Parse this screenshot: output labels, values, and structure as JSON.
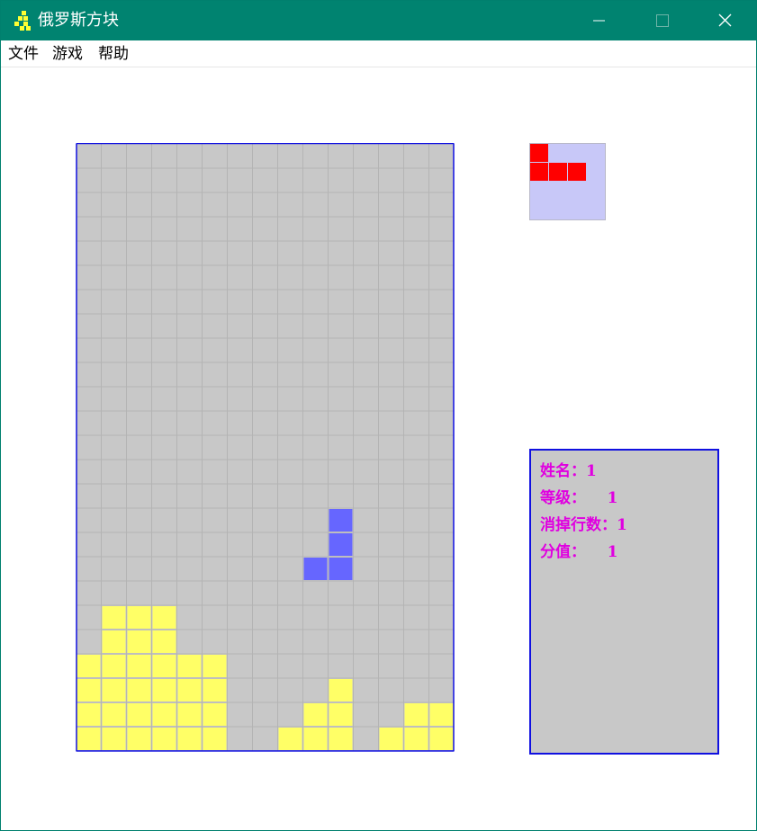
{
  "window": {
    "title": "俄罗斯方块",
    "controls": {
      "minimize": "minimize-icon",
      "maximize": "maximize-icon",
      "close": "close-icon"
    },
    "colors": {
      "titlebar": "#008370"
    }
  },
  "menu": [
    {
      "label": "文件"
    },
    {
      "label": "游戏"
    },
    {
      "label": "帮助"
    }
  ],
  "board": {
    "columns": 15,
    "rows": 25,
    "colors": {
      "empty": "#c8c8c8",
      "grid": "#b4b4b4",
      "stack": "#ffff66",
      "active": "#6666ff",
      "border": "#1010e0"
    },
    "stack_cells": [
      [
        1,
        19
      ],
      [
        2,
        19
      ],
      [
        3,
        19
      ],
      [
        1,
        20
      ],
      [
        2,
        20
      ],
      [
        3,
        20
      ],
      [
        0,
        21
      ],
      [
        1,
        21
      ],
      [
        2,
        21
      ],
      [
        3,
        21
      ],
      [
        4,
        21
      ],
      [
        5,
        21
      ],
      [
        0,
        22
      ],
      [
        1,
        22
      ],
      [
        2,
        22
      ],
      [
        3,
        22
      ],
      [
        4,
        22
      ],
      [
        5,
        22
      ],
      [
        10,
        22
      ],
      [
        0,
        23
      ],
      [
        1,
        23
      ],
      [
        2,
        23
      ],
      [
        3,
        23
      ],
      [
        4,
        23
      ],
      [
        5,
        23
      ],
      [
        9,
        23
      ],
      [
        10,
        23
      ],
      [
        13,
        23
      ],
      [
        14,
        23
      ],
      [
        0,
        24
      ],
      [
        1,
        24
      ],
      [
        2,
        24
      ],
      [
        3,
        24
      ],
      [
        4,
        24
      ],
      [
        5,
        24
      ],
      [
        8,
        24
      ],
      [
        9,
        24
      ],
      [
        10,
        24
      ],
      [
        12,
        24
      ],
      [
        13,
        24
      ],
      [
        14,
        24
      ]
    ],
    "active_piece": [
      [
        10,
        15
      ],
      [
        10,
        16
      ],
      [
        9,
        17
      ],
      [
        10,
        17
      ]
    ]
  },
  "next_piece": {
    "background": "#c8c8f8",
    "color": "#ff0000",
    "cells": [
      [
        0,
        0
      ],
      [
        0,
        1
      ],
      [
        1,
        1
      ],
      [
        2,
        1
      ]
    ]
  },
  "stats": [
    {
      "label": "姓名：",
      "value": "1"
    },
    {
      "label": "等级：",
      "value": "    1"
    },
    {
      "label": "消掉行数：",
      "value": "1"
    },
    {
      "label": "分值：",
      "value": "    1"
    }
  ]
}
